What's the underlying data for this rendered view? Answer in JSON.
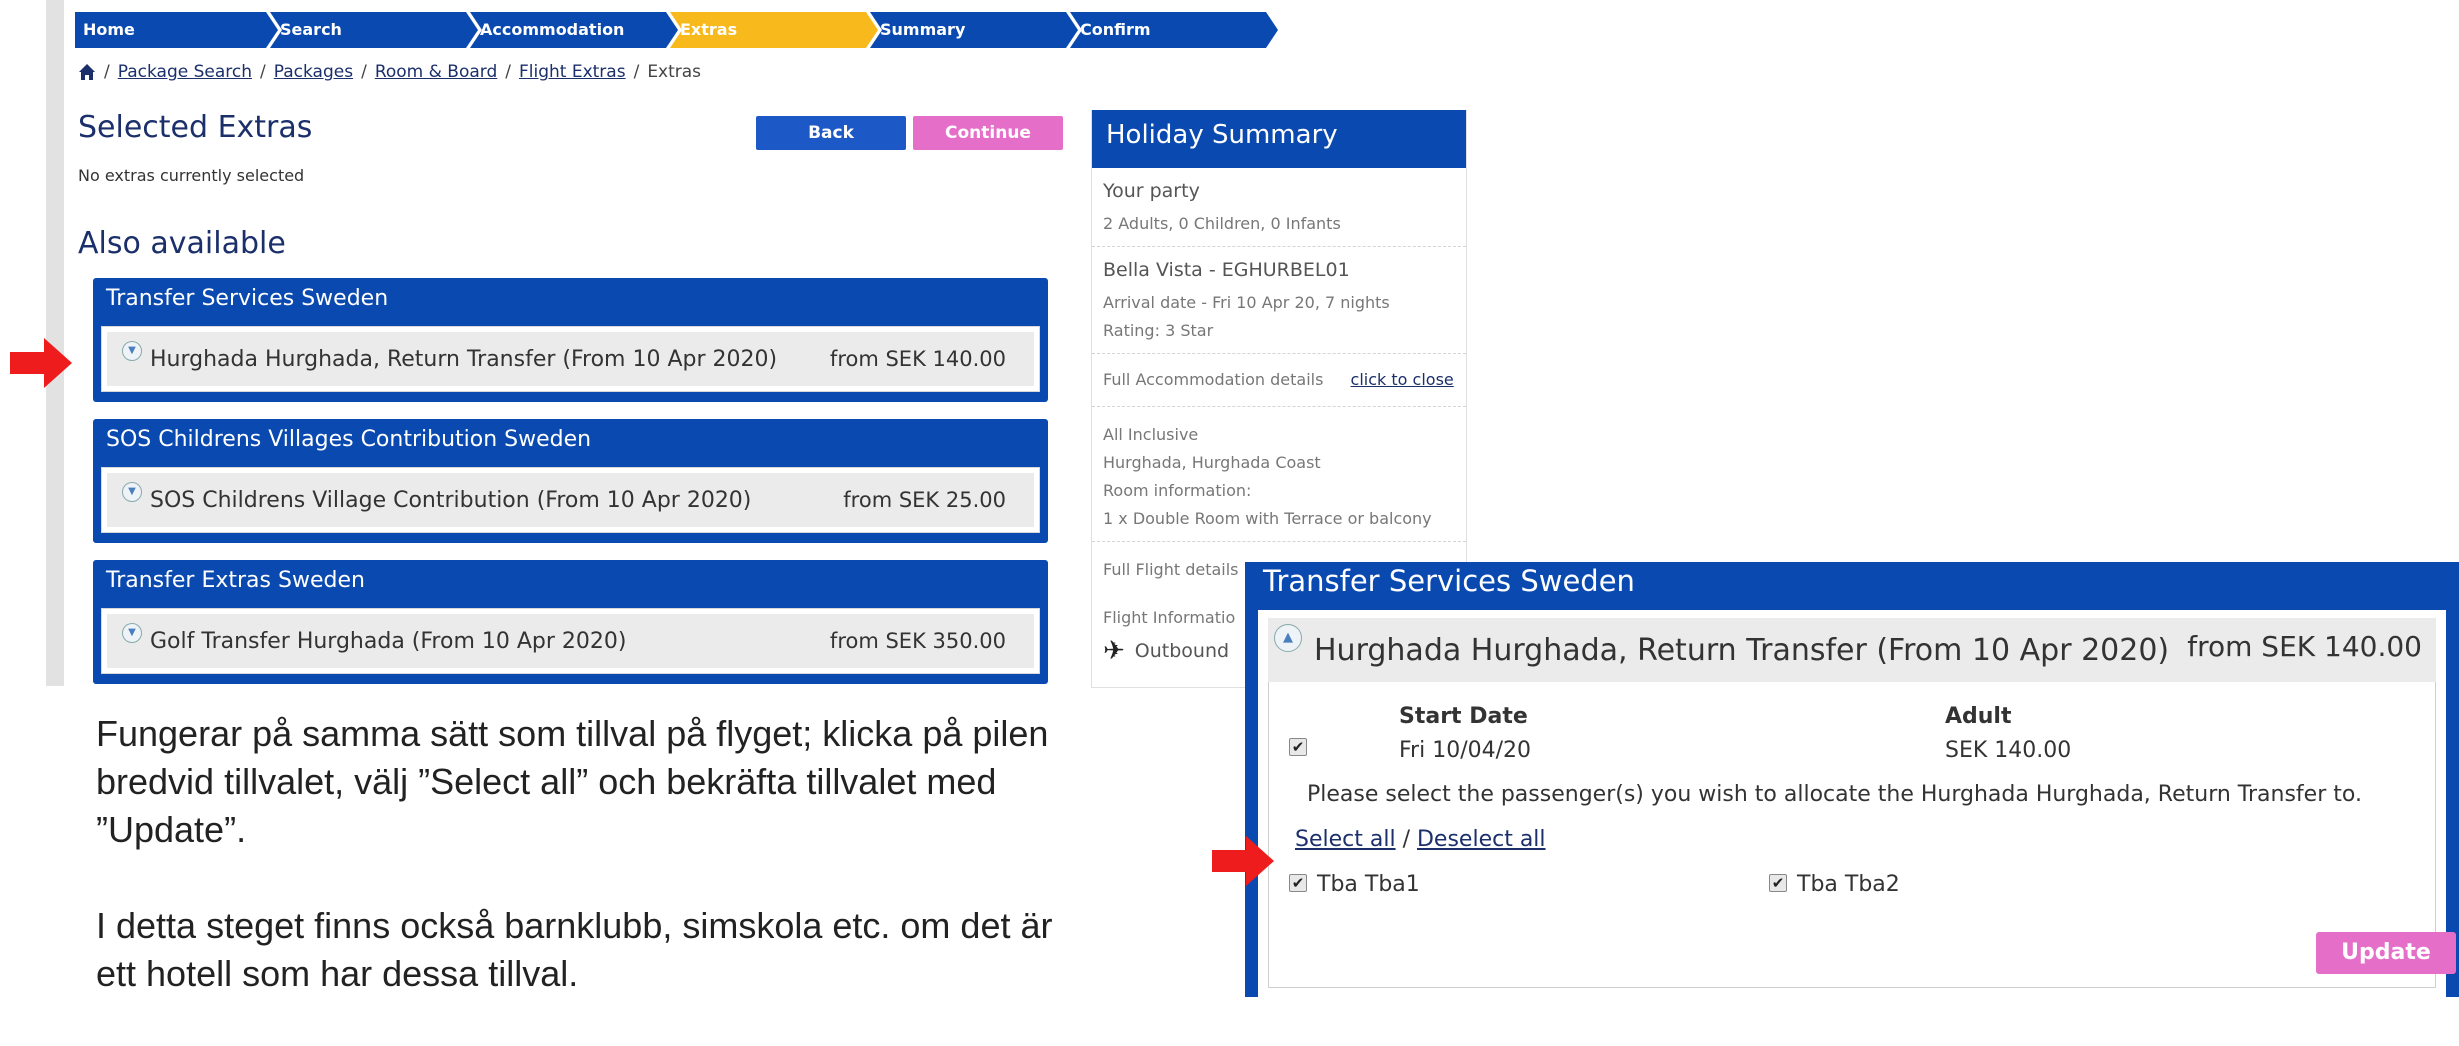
{
  "steps": [
    "Home",
    "Search",
    "Accommodation",
    "Extras",
    "Summary",
    "Confirm"
  ],
  "active_step": "Extras",
  "breadcrumb": {
    "items": [
      "Package Search",
      "Packages",
      "Room & Board",
      "Flight Extras"
    ],
    "current": "Extras",
    "separator": "/"
  },
  "selected": {
    "title": "Selected Extras",
    "empty_text": "No extras currently selected"
  },
  "buttons": {
    "back": "Back",
    "continue": "Continue",
    "update": "Update"
  },
  "also": {
    "title": "Also available",
    "panels": [
      {
        "title": "Transfer Services Sweden",
        "item": "Hurghada Hurghada, Return Transfer (From 10 Apr 2020)",
        "price": "from SEK 140.00"
      },
      {
        "title": "SOS Childrens Villages Contribution Sweden",
        "item": "SOS Childrens Village Contribution (From 10 Apr 2020)",
        "price": "from SEK 25.00"
      },
      {
        "title": "Transfer Extras Sweden",
        "item": "Golf Transfer Hurghada (From 10 Apr 2020)",
        "price": "from SEK 350.00"
      }
    ]
  },
  "summary": {
    "title": "Holiday Summary",
    "party_label": "Your party",
    "party_value": "2 Adults, 0 Children, 0 Infants",
    "hotel": "Bella Vista - EGHURBEL01",
    "arrival": "Arrival date - Fri 10 Apr 20, 7 nights",
    "rating": "Rating: 3 Star",
    "accom_label": "Full Accommodation details",
    "accom_link": "click to close",
    "board": "All Inclusive",
    "location": "Hurghada, Hurghada Coast",
    "room_info": "Room information:",
    "room": "1 x Double Room with Terrace or balcony",
    "flight_label": "Full Flight details",
    "flight_info": "Flight Informatio",
    "outbound": "Outbound"
  },
  "instructions": {
    "p1": "Fungerar på samma sätt som tillval på flyget; klicka på pilen bredvid tillvalet, välj ”Select all” och bekräfta tillvalet med ”Update”.",
    "p2": "I detta steget finns också barnklubb, simskola etc. om det är ett hotell som har dessa tillval."
  },
  "zoom": {
    "title": "Transfer Services Sweden",
    "item": "Hurghada Hurghada, Return Transfer (From 10 Apr 2020)",
    "price": "from SEK 140.00",
    "col_start": "Start Date",
    "col_adult": "Adult",
    "start_value": "Fri 10/04/20",
    "adult_value": "SEK 140.00",
    "allocate_text": "Please select the passenger(s) you wish to allocate the Hurghada Hurghada, Return Transfer to.",
    "select_all": "Select all",
    "deselect_all": "Deselect all",
    "passengers": [
      "Tba Tba1",
      "Tba Tba2"
    ]
  },
  "colors": {
    "brand_blue": "#0a4ab0",
    "active_step": "#f7b91b",
    "continue_pink": "#e56fc8",
    "arrow_red": "#ee1c1c"
  },
  "icons": [
    "home-icon",
    "expand-down-icon",
    "collapse-up-icon",
    "plane-icon",
    "red-arrow-icon",
    "checkbox-icon"
  ]
}
